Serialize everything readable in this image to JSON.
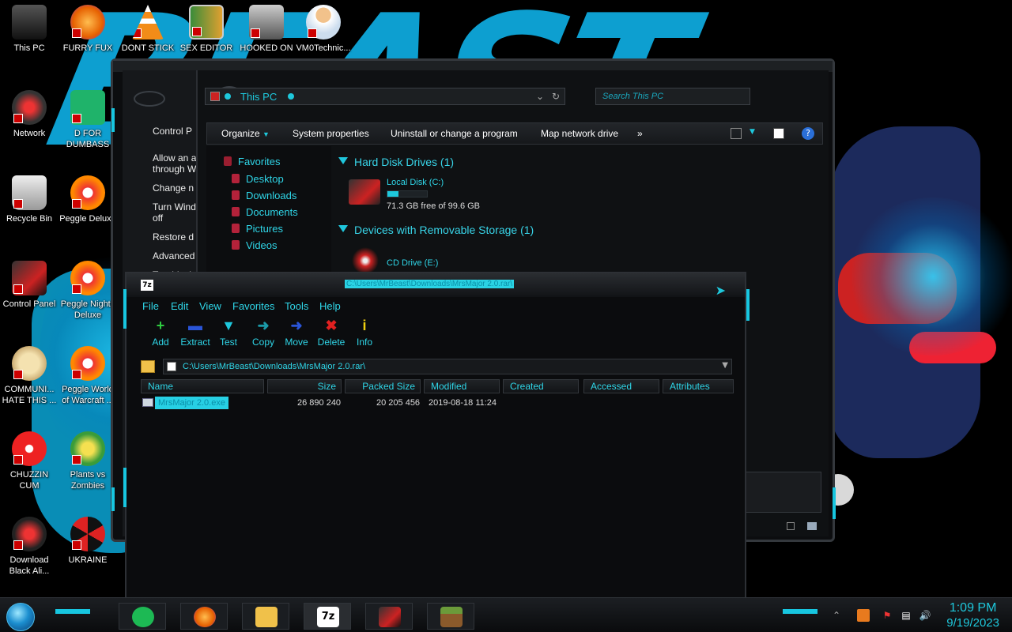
{
  "colors": {
    "accent": "#1ec8dc",
    "selection": "#27d0e4",
    "window_bg": "#0c0d0f",
    "wallpaper_blue": "#0ea8dc"
  },
  "wallpaper": {
    "text": "BEAST"
  },
  "desktop_icons": [
    {
      "label": "This PC",
      "icon": "computer-icon"
    },
    {
      "label": "FURRY FUX",
      "icon": "firefox-icon"
    },
    {
      "label": "DONT STICK",
      "icon": "vlc-icon"
    },
    {
      "label": "SEX EDITOR",
      "icon": "hxd-icon"
    },
    {
      "label": "HOOKED ON",
      "icon": "game-icon"
    },
    {
      "label": "VM0Technic...",
      "icon": "doctor-icon"
    },
    {
      "label": "Network",
      "icon": "network-icon"
    },
    {
      "label": "D FOR DUMBASS",
      "icon": "document-icon"
    },
    {
      "label": "Recycle Bin",
      "icon": "recycle-bin-icon"
    },
    {
      "label": "Peggle Deluxe",
      "icon": "peggle-icon"
    },
    {
      "label": "Control Panel",
      "icon": "control-panel-icon"
    },
    {
      "label": "Peggle Nights Deluxe",
      "icon": "peggle-icon"
    },
    {
      "label": "COMMUNI... HATE THIS ...",
      "icon": "money-bag-icon"
    },
    {
      "label": "Peggle World of Warcraft ...",
      "icon": "peggle-icon"
    },
    {
      "label": "CHUZZIN CUM",
      "icon": "chuzzle-icon"
    },
    {
      "label": "Plants vs Zombies",
      "icon": "plant-icon"
    },
    {
      "label": "Download Black Ali...",
      "icon": "alien-icon"
    },
    {
      "label": "UKRAINE",
      "icon": "radiation-icon"
    }
  ],
  "explorer": {
    "control_panel_items": [
      "Control P",
      "Allow an a through W",
      "Change n",
      "Turn Wind off",
      "Restore d",
      "Advanced",
      "Troublesh"
    ],
    "address": "This PC",
    "search_placeholder": "Search This PC",
    "toolbar": [
      "Organize",
      "System properties",
      "Uninstall or change a program",
      "Map network drive",
      "»"
    ],
    "nav": {
      "favorites": "Favorites",
      "items": [
        "Desktop",
        "Downloads",
        "Documents",
        "Pictures",
        "Videos"
      ]
    },
    "sections": {
      "hdd_header": "Hard Disk Drives (1)",
      "local_disk": "Local Disk (C:)",
      "local_disk_free": "71.3 GB free of 99.6 GB",
      "local_disk_used_fraction": 0.285,
      "removable_header": "Devices with Removable Storage (1)",
      "cd_drive": "CD Drive (E:)"
    }
  },
  "zip": {
    "app_icon": "7z",
    "title_path": "C:\\Users\\MrBeast\\Downloads\\MrsMajor 2.0.rar\\",
    "menu": [
      "File",
      "Edit",
      "View",
      "Favorites",
      "Tools",
      "Help"
    ],
    "tools": [
      {
        "label": "Add",
        "glyph": "+",
        "color": "#2ecc40"
      },
      {
        "label": "Extract",
        "glyph": "▬",
        "color": "#2a55d8"
      },
      {
        "label": "Test",
        "glyph": "▼",
        "color": "#1ec8dc"
      },
      {
        "label": "Copy",
        "glyph": "➜",
        "color": "#1b9aa8"
      },
      {
        "label": "Move",
        "glyph": "➜",
        "color": "#2a55d8"
      },
      {
        "label": "Delete",
        "glyph": "✖",
        "color": "#e02020"
      },
      {
        "label": "Info",
        "glyph": "i",
        "color": "#f0d010"
      }
    ],
    "address": "C:\\Users\\MrBeast\\Downloads\\MrsMajor 2.0.rar\\",
    "columns": [
      "Name",
      "Size",
      "Packed Size",
      "Modified",
      "Created",
      "Accessed",
      "Attributes"
    ],
    "rows": [
      {
        "name": "MrsMajor 2.0.exe",
        "size": "26 890 240",
        "packed": "20 205 456",
        "modified": "2019-08-18 11:24"
      }
    ]
  },
  "taskbar": {
    "apps": [
      "spotify-icon",
      "firefox-icon",
      "file-explorer-icon",
      "7zip-icon",
      "control-panel-icon",
      "minecraft-icon"
    ],
    "zip_label": "7z",
    "time": "1:09 PM",
    "date": "9/19/2023"
  }
}
